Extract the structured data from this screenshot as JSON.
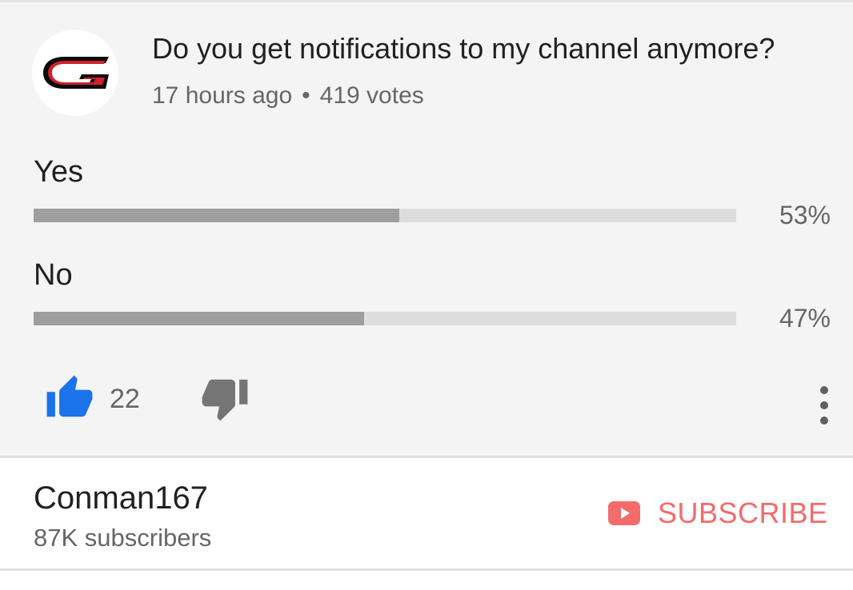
{
  "post": {
    "question": "Do you get notifications to my channel anymore?",
    "time_ago": "17 hours ago",
    "separator": "•",
    "votes": "419 votes"
  },
  "poll": {
    "options": [
      {
        "label": "Yes",
        "percent_text": "53%",
        "fraction": 0.52
      },
      {
        "label": "No",
        "percent_text": "47%",
        "fraction": 0.47
      }
    ]
  },
  "actions": {
    "like_count": "22",
    "like_icon": "thumbs-up-icon",
    "dislike_icon": "thumbs-down-icon",
    "more_icon": "more-vertical-icon"
  },
  "channel": {
    "name": "Conman167",
    "subscribers": "87K subscribers",
    "subscribe_label": "SUBSCRIBE",
    "avatar_icon": "channel-logo-icon"
  },
  "colors": {
    "like_blue": "#1a73e8",
    "subscribe_red": "#f36b6b",
    "bar_fill": "#9e9e9e",
    "bar_track": "#dddddd"
  }
}
